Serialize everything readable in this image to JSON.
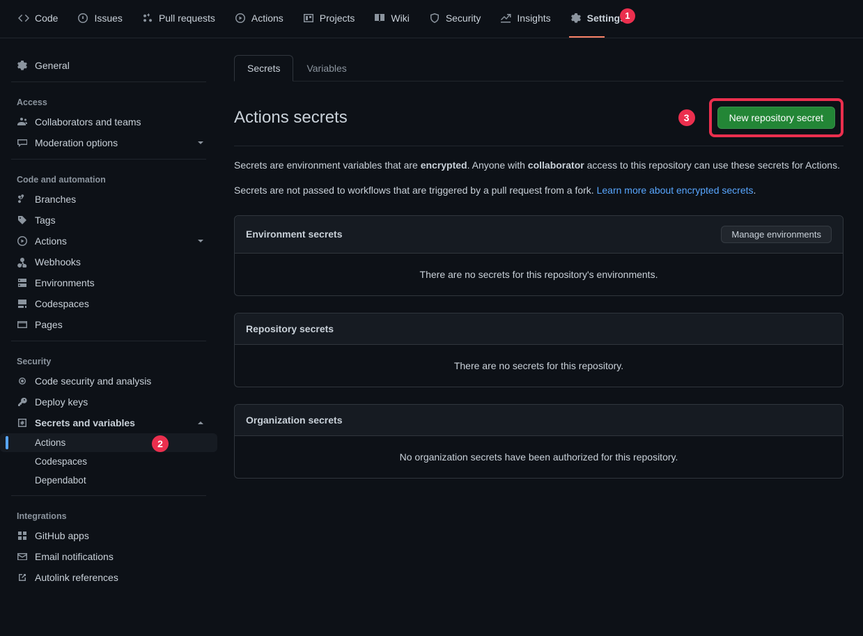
{
  "topnav": {
    "code": "Code",
    "issues": "Issues",
    "pulls": "Pull requests",
    "actions": "Actions",
    "projects": "Projects",
    "wiki": "Wiki",
    "security": "Security",
    "insights": "Insights",
    "settings": "Settings",
    "step1_badge": "1"
  },
  "sidebar": {
    "general": "General",
    "access_title": "Access",
    "collaborators": "Collaborators and teams",
    "moderation": "Moderation options",
    "code_auto_title": "Code and automation",
    "branches": "Branches",
    "tags": "Tags",
    "actions": "Actions",
    "webhooks": "Webhooks",
    "environments": "Environments",
    "codespaces": "Codespaces",
    "pages": "Pages",
    "security_title": "Security",
    "code_security": "Code security and analysis",
    "deploy_keys": "Deploy keys",
    "secrets_vars": "Secrets and variables",
    "sub_actions": "Actions",
    "sub_codespaces": "Codespaces",
    "sub_dependabot": "Dependabot",
    "step2_badge": "2",
    "integrations_title": "Integrations",
    "github_apps": "GitHub apps",
    "email_notifications": "Email notifications",
    "autolink": "Autolink references"
  },
  "tabs": {
    "secrets": "Secrets",
    "variables": "Variables"
  },
  "header": {
    "title": "Actions secrets",
    "new_secret_btn": "New repository secret",
    "step3_badge": "3"
  },
  "description": {
    "p1_a": "Secrets are environment variables that are ",
    "p1_b": "encrypted",
    "p1_c": ". Anyone with ",
    "p1_d": "collaborator",
    "p1_e": " access to this repository can use these secrets for Actions.",
    "p2_a": "Secrets are not passed to workflows that are triggered by a pull request from a fork. ",
    "p2_link": "Learn more about encrypted secrets",
    "p2_b": "."
  },
  "panels": {
    "env_title": "Environment secrets",
    "manage_env_btn": "Manage environments",
    "env_empty": "There are no secrets for this repository's environments.",
    "repo_title": "Repository secrets",
    "repo_empty": "There are no secrets for this repository.",
    "org_title": "Organization secrets",
    "org_empty": "No organization secrets have been authorized for this repository."
  }
}
